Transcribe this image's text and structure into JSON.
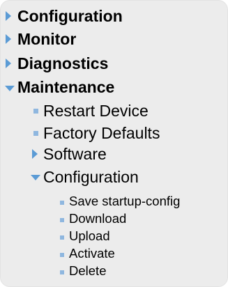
{
  "menu": {
    "configuration": "Configuration",
    "monitor": "Monitor",
    "diagnostics": "Diagnostics",
    "maintenance": {
      "label": "Maintenance",
      "restart_device": "Restart Device",
      "factory_defaults": "Factory Defaults",
      "software": "Software",
      "configuration": {
        "label": "Configuration",
        "save_startup_config": "Save startup-config",
        "download": "Download",
        "upload": "Upload",
        "activate": "Activate",
        "delete": "Delete"
      }
    }
  },
  "colors": {
    "panel_background": "#ececec",
    "arrow": "#5b9bd5",
    "bullet": "#8fb7df",
    "text": "#000000"
  },
  "icons": {
    "collapsed": "triangle-right-icon",
    "expanded": "triangle-down-icon",
    "leaf": "square-bullet-icon"
  }
}
